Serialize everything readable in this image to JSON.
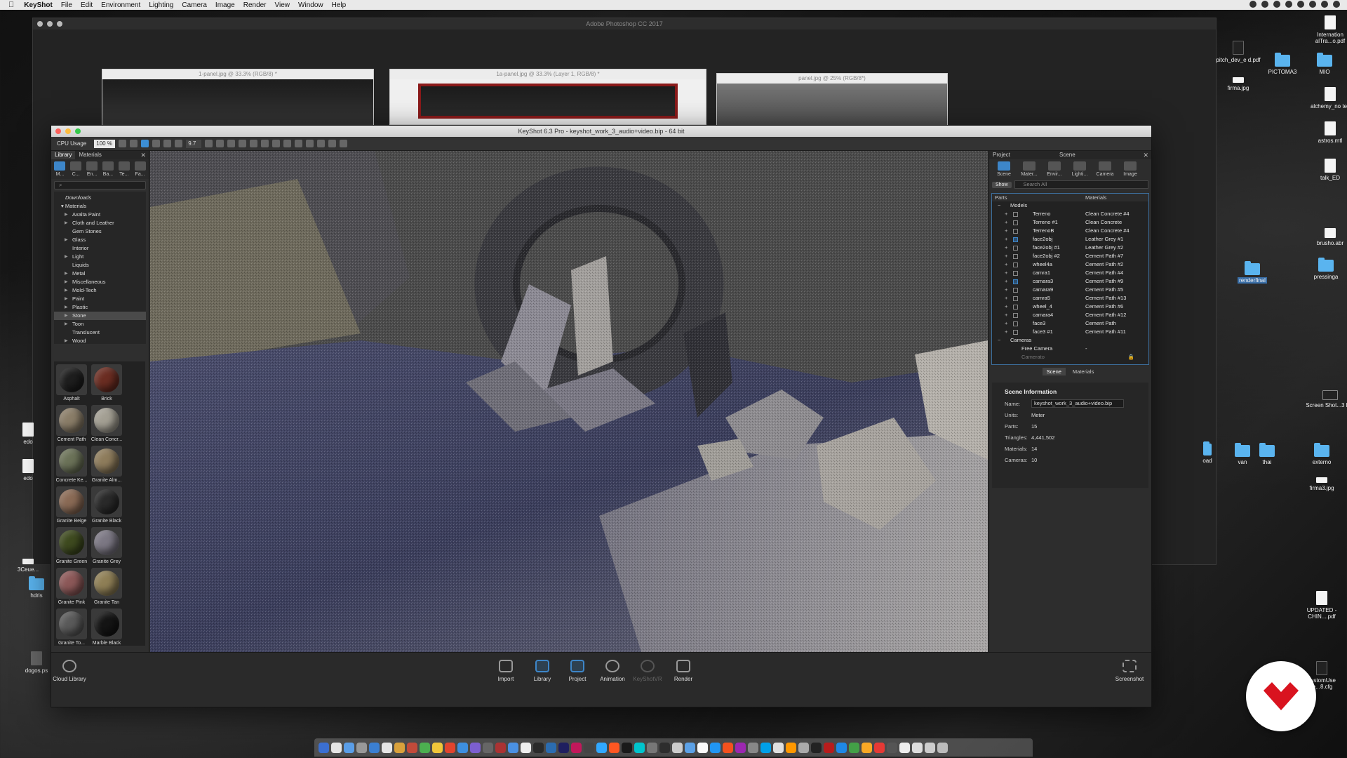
{
  "menubar": {
    "app_name": "KeyShot",
    "items": [
      "File",
      "Edit",
      "Environment",
      "Lighting",
      "Camera",
      "Image",
      "Render",
      "View",
      "Window",
      "Help"
    ]
  },
  "photoshop": {
    "title": "Adobe Photoshop CC 2017",
    "docs": [
      "1-panel.jpg @ 33.3% (RGB/8) *",
      "1a-panel.jpg @ 33.3% (Layer 1, RGB/8) *",
      "panel.jpg @ 25% (RGB/8*)"
    ]
  },
  "desktop_icons": {
    "right": [
      "Internation alTra...o.pdf",
      "pitch_dev_e d.pdf",
      "PICTOMA3",
      "MIO",
      "firma.jpg",
      "alchemy_no tes",
      "astros.mtl",
      "talk_ED",
      "brusho.abr",
      "renderfinal",
      "pressinga",
      "Screen Shot...3 PM",
      "oad",
      "van",
      "thai",
      "externo",
      "firma3.jpg",
      "UPDATED - CHIN....pdf",
      "customUse te...8.cfg"
    ],
    "left": [
      "edo",
      "edo",
      "3Ceue...",
      "hdris",
      "dogos.ps"
    ]
  },
  "keyshot": {
    "title": "KeyShot 6.3 Pro  -  keyshot_work_3_audio+video.bip  - 64 bit",
    "toolbar": {
      "cpu_label": "CPU Usage",
      "cpu_value": "100 %",
      "frame_value": "9.7"
    },
    "library": {
      "tabs": [
        "Library",
        "Materials"
      ],
      "icons": [
        "M...",
        "C...",
        "En...",
        "Ba...",
        "Te...",
        "Fa..."
      ],
      "tree": {
        "downloads": "Downloads",
        "root": "Materials",
        "items": [
          "Axalta Paint",
          "Cloth and Leather",
          "Gem Stones",
          "Glass",
          "Interior",
          "Light",
          "Liquids",
          "Metal",
          "Miscellaneous",
          "Mold-Tech",
          "Paint",
          "Plastic",
          "Stone",
          "Toon",
          "Translucent",
          "Wood"
        ],
        "selected": "Stone"
      },
      "materials": [
        {
          "name": "Asphalt",
          "color": "#1e1e1e"
        },
        {
          "name": "Brick",
          "color": "#6b2d22"
        },
        {
          "name": "Cement Path",
          "color": "#8a7d68"
        },
        {
          "name": "Clean Concr...",
          "color": "#a39f93"
        },
        {
          "name": "Concrete Ke...",
          "color": "#6b7258"
        },
        {
          "name": "Granite Alm...",
          "color": "#8e7c5c"
        },
        {
          "name": "Granite Beige",
          "color": "#8a6a55"
        },
        {
          "name": "Granite Black",
          "color": "#2a2a2a"
        },
        {
          "name": "Granite Green",
          "color": "#3e4a1f"
        },
        {
          "name": "Granite Grey",
          "color": "#7c7884"
        },
        {
          "name": "Granite Pink",
          "color": "#8c5858"
        },
        {
          "name": "Granite Tan",
          "color": "#8f7f56"
        },
        {
          "name": "Granite To...",
          "color": "#5a5a5a"
        },
        {
          "name": "Marble Black",
          "color": "#151515"
        }
      ],
      "cloud_label": "Cloud Library"
    },
    "project": {
      "header": [
        "Project",
        "Scene"
      ],
      "icons": [
        "Scene",
        "Mater...",
        "Envir...",
        "Lighti...",
        "Camera",
        "Image"
      ],
      "show_label": "Show",
      "search_placeholder": "Search All",
      "columns": [
        "Parts",
        "Materials"
      ],
      "models_label": "Models",
      "parts": [
        {
          "name": "Terreno",
          "material": "Clean Concrete #4",
          "checked": false
        },
        {
          "name": "Terreno #1",
          "material": "Clean Concrete",
          "checked": false
        },
        {
          "name": "TerrenoB",
          "material": "Clean Concrete #4",
          "checked": false
        },
        {
          "name": "face2obj",
          "material": "Leather Grey #1",
          "checked": true
        },
        {
          "name": "face2obj #1",
          "material": "Leather Grey #2",
          "checked": false
        },
        {
          "name": "face2obj #2",
          "material": "Cement Path #7",
          "checked": false
        },
        {
          "name": "wheel4a",
          "material": "Cement Path #2",
          "checked": false
        },
        {
          "name": "camra1",
          "material": "Cement Path #4",
          "checked": false
        },
        {
          "name": "camara3",
          "material": "Cement Path #9",
          "checked": true
        },
        {
          "name": "camara9",
          "material": "Cement Path #5",
          "checked": false
        },
        {
          "name": "camra5",
          "material": "Cement Path #13",
          "checked": false
        },
        {
          "name": "wheel_4",
          "material": "Cement Path #6",
          "checked": false
        },
        {
          "name": "camara4",
          "material": "Cement Path #12",
          "checked": false
        },
        {
          "name": "face3",
          "material": "Cement Path",
          "checked": false
        },
        {
          "name": "face3 #1",
          "material": "Cement Path #11",
          "checked": false
        }
      ],
      "cameras_label": "Cameras",
      "cameras": [
        {
          "name": "Free Camera",
          "material": "-"
        },
        {
          "name": "Camerato",
          "material": ""
        }
      ],
      "sub_tabs": [
        "Scene",
        "Materials"
      ],
      "scene_info": {
        "title": "Scene Information",
        "name_label": "Name:",
        "name_value": "keyshot_work_3_audio+video.bip",
        "units_label": "Units:",
        "units_value": "Meter",
        "parts_label": "Parts:",
        "parts_value": "15",
        "triangles_label": "Triangles:",
        "triangles_value": "4,441,502",
        "materials_label": "Materials:",
        "materials_value": "14",
        "cameras_label": "Cameras:",
        "cameras_value": "10"
      }
    },
    "ribbon": {
      "buttons": [
        "Import",
        "Library",
        "Project",
        "Animation",
        "KeyShotVR",
        "Render"
      ],
      "screenshot": "Screenshot"
    }
  },
  "colors": {
    "accent": "#3d86c9",
    "viewport_sky": "#4a4a4a",
    "ground_blue": "#3b3e5c",
    "badge_red": "#d9131f"
  }
}
